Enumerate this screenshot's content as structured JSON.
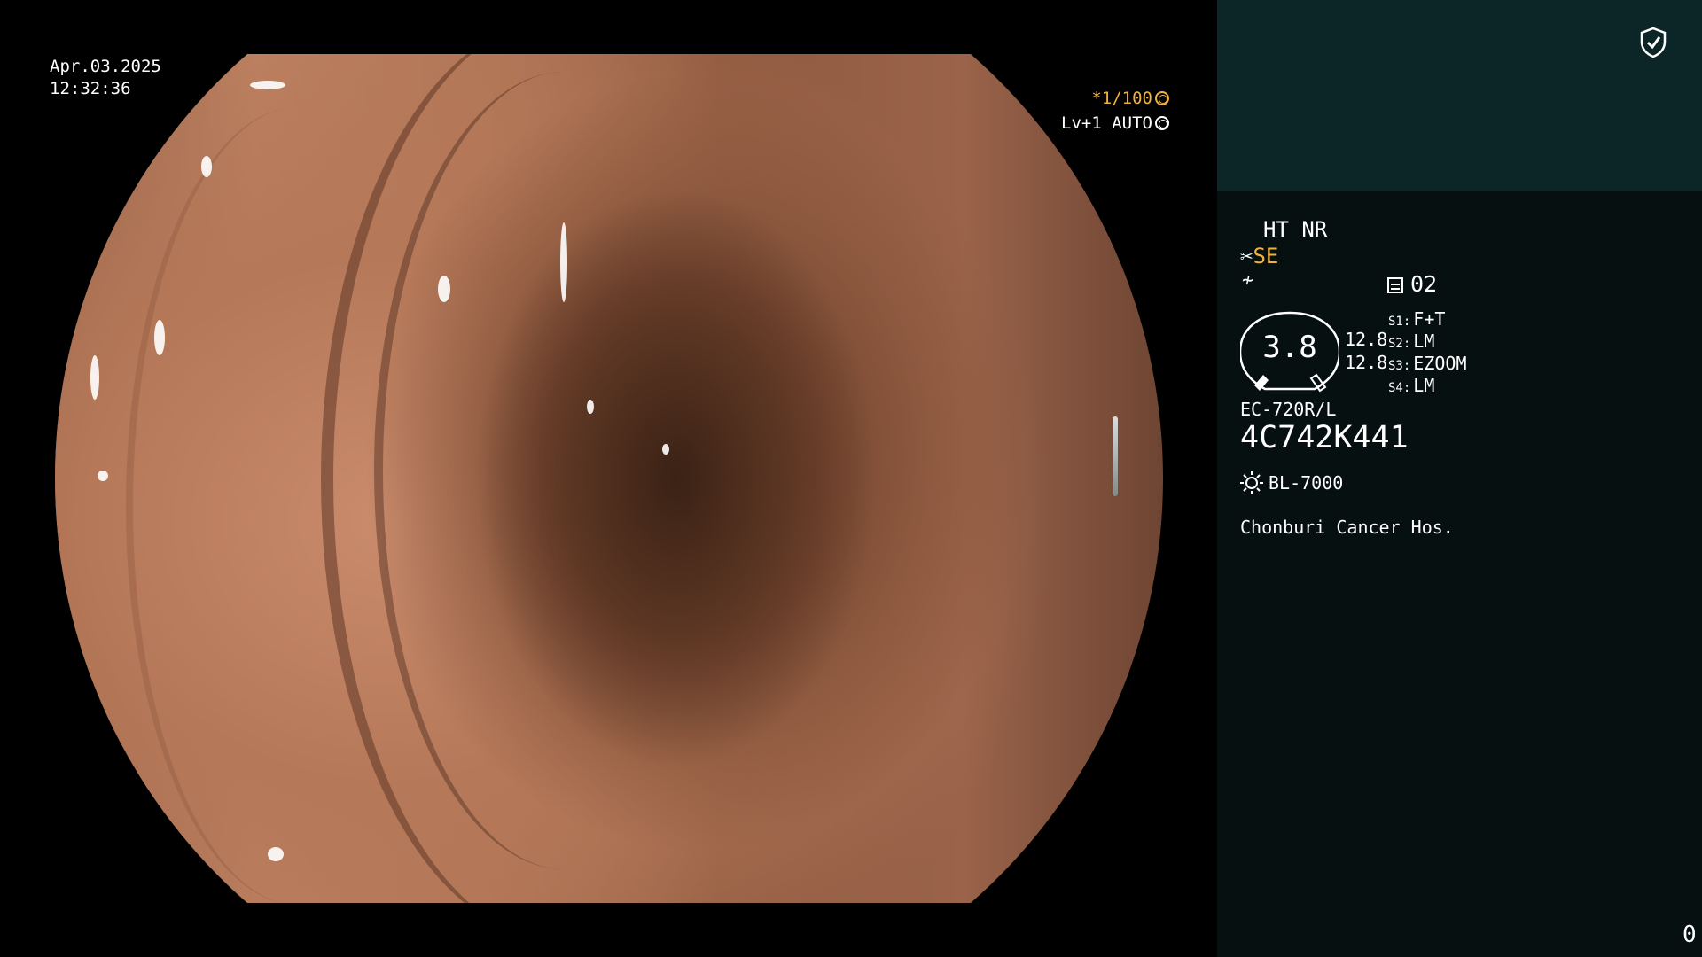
{
  "osd": {
    "date": "Apr.03.2025",
    "time": "12:32:36",
    "shutter_speed": "*1/100",
    "iris_mode": "Lv+1 AUTO"
  },
  "panel": {
    "mode": "HT NR",
    "enhancement": "SE",
    "memory_slot": "02",
    "gauge_value": "3.8",
    "gauge_sub_top": "12.8",
    "gauge_sub_bottom": "12.8",
    "switches": [
      {
        "label": "S1:",
        "value": "F+T"
      },
      {
        "label": "S2:",
        "value": "LM"
      },
      {
        "label": "S3:",
        "value": "EZOOM"
      },
      {
        "label": "S4:",
        "value": "LM"
      }
    ],
    "scope_model": "EC-720R/L",
    "scope_serial": "4C742K441",
    "light_source": "BL-7000",
    "hospital": "Chonburi Cancer Hos.",
    "image_counter": "0"
  },
  "icons": [
    "shield-check-icon",
    "shutter-icon",
    "iris-icon",
    "scissors-icon",
    "filter-icon",
    "memory-icon",
    "light-source-icon"
  ],
  "colors": {
    "highlight": "#f0b23c",
    "panel_top": "#0c2527",
    "panel_bg": "#071011"
  }
}
